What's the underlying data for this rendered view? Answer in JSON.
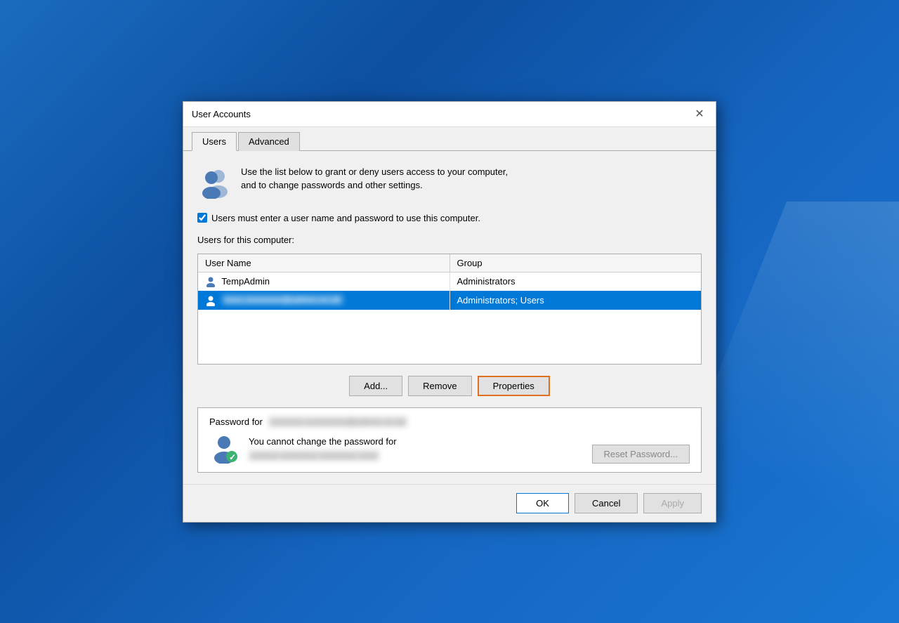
{
  "dialog": {
    "title": "User Accounts",
    "tabs": [
      {
        "id": "users",
        "label": "Users",
        "active": true
      },
      {
        "id": "advanced",
        "label": "Advanced",
        "active": false
      }
    ]
  },
  "users_tab": {
    "description_line1": "Use the list below to grant or deny users access to your computer,",
    "description_line2": "and to change passwords and other settings.",
    "checkbox_label": "Users must enter a user name and password to use this computer.",
    "checkbox_checked": true,
    "table_section_label": "Users for this computer:",
    "table": {
      "columns": [
        "User Name",
        "Group"
      ],
      "rows": [
        {
          "username": "TempAdmin",
          "group": "Administrators",
          "selected": false,
          "blurred": false
        },
        {
          "username": "●●●●●●●●●●●●●.co.uk",
          "group": "Administrators; Users",
          "selected": true,
          "blurred": true
        }
      ]
    },
    "buttons": {
      "add": "Add...",
      "remove": "Remove",
      "properties": "Properties"
    },
    "password_section": {
      "title_prefix": "Password for",
      "title_blurred": "●●●●●●●●●●●●●●●●",
      "cannot_change": "You cannot change the password for",
      "username_blurred": "●●●●●● ●●●●●●●● ●●●●●● ●●●●",
      "reset_button": "Reset Password..."
    }
  },
  "bottom_buttons": {
    "ok": "OK",
    "cancel": "Cancel",
    "apply": "Apply"
  },
  "colors": {
    "selected_row_bg": "#0078d7",
    "properties_highlight": "#e07020",
    "ok_border": "#0078d7"
  }
}
